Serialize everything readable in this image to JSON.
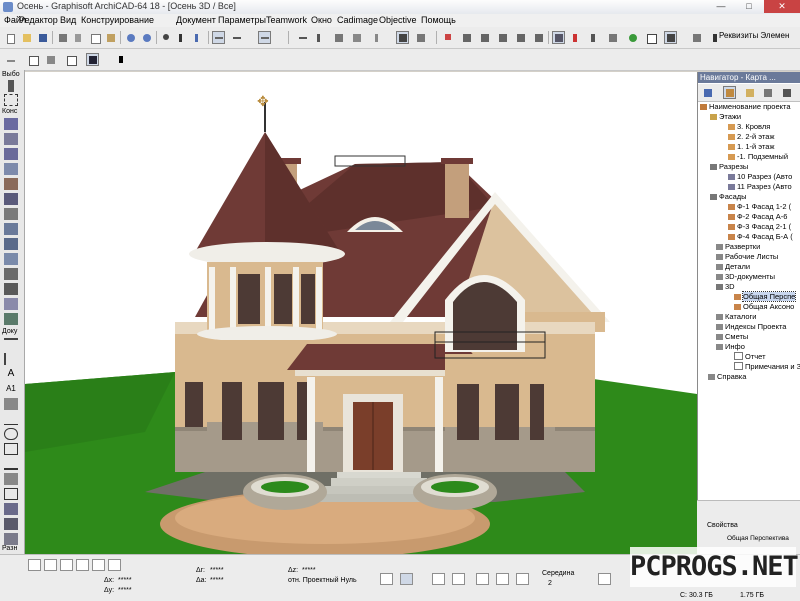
{
  "window": {
    "title": "Осень - Graphisoft ArchiCAD-64 18 - [Осень 3D / Все]",
    "minimize": "—",
    "maximize": "□",
    "close": "✕"
  },
  "menu": [
    "Файл",
    "Редактор",
    "Вид",
    "Конструирование",
    "Документ",
    "Параметры",
    "Teamwork",
    "Окно",
    "Cadimage",
    "Objective",
    "Помощь"
  ],
  "toolbar": {
    "properties_label": "Реквизиты Элемен"
  },
  "toolbox": {
    "labels": [
      "Выбо",
      "Конс",
      "Доку",
      "Разн"
    ]
  },
  "navigator": {
    "title": "Навигатор - Карта ...",
    "tree": [
      {
        "label": "Наименование проекта",
        "level": 0
      },
      {
        "label": "Этажи",
        "level": 1
      },
      {
        "label": "3. Кровля",
        "level": 2
      },
      {
        "label": "2. 2-й этаж",
        "level": 2
      },
      {
        "label": "1. 1-й этаж",
        "level": 2
      },
      {
        "label": "-1. Подземный",
        "level": 2
      },
      {
        "label": "Разрезы",
        "level": 1
      },
      {
        "label": "10 Разрез (Авто",
        "level": 2
      },
      {
        "label": "11 Разрез (Авто",
        "level": 2
      },
      {
        "label": "Фасады",
        "level": 1
      },
      {
        "label": "Ф-1 Фасад 1-2 (",
        "level": 2
      },
      {
        "label": "Ф-2 Фасад А-6",
        "level": 2
      },
      {
        "label": "Ф-3 Фасад 2-1 (",
        "level": 2
      },
      {
        "label": "Ф-4 Фасад Б-А (",
        "level": 2
      },
      {
        "label": "Развертки",
        "level": 1
      },
      {
        "label": "Рабочие Листы",
        "level": 1
      },
      {
        "label": "Детали",
        "level": 1
      },
      {
        "label": "3D-документы",
        "level": 1
      },
      {
        "label": "3D",
        "level": 1
      },
      {
        "label": "Общая Перспе",
        "level": 2,
        "selected": true
      },
      {
        "label": "Общая Аксоно",
        "level": 2
      },
      {
        "label": "Каталоги",
        "level": 1
      },
      {
        "label": "Индексы Проекта",
        "level": 1
      },
      {
        "label": "Сметы",
        "level": 1
      },
      {
        "label": "Инфо",
        "level": 1
      },
      {
        "label": "Отчет",
        "level": 2
      },
      {
        "label": "Примечания и З",
        "level": 2
      },
      {
        "label": "Справка",
        "level": 0
      }
    ],
    "properties_label": "Свойства",
    "properties_value": "Общая Перспектива"
  },
  "status": {
    "dx_label": "Δx:",
    "dx_value": "*****",
    "dy_label": "Δy:",
    "dy_value": "*****",
    "dr_label": "Δr:",
    "dr_value": "*****",
    "da_label": "Δa:",
    "da_value": "*****",
    "dz_label": "Δz:",
    "dz_value": "*****",
    "ref_label": "отн. Проектный Нуль",
    "middle_label": "Середина",
    "middle_value": "2",
    "disk_c": "C: 30.3 ГБ",
    "disk_2": "1.75 ГБ"
  },
  "watermark": "PCPROGS.NET",
  "colors": {
    "roof": "#6f3a36",
    "wall": "#d9b98f",
    "stone": "#a59a8a",
    "grass": "#2e8a1a",
    "sky": "#ffffff",
    "accent_selected": "#c9d7ef"
  }
}
